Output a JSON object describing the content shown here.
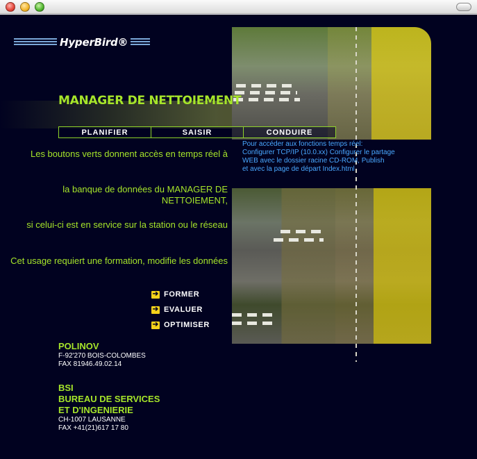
{
  "window": {
    "controls": [
      "close",
      "minimize",
      "zoom"
    ]
  },
  "logo": {
    "text": "HyperBird®"
  },
  "title": "MANAGER DE NETTOIEMENT",
  "nav": [
    {
      "label": "PLANIFIER"
    },
    {
      "label": "SAISIR"
    },
    {
      "label": "CONDUIRE"
    }
  ],
  "info": {
    "line1": "Pour accéder aux fonctions temps réel:",
    "line2": "Configurer TCP/IP (10.0.xx) Configurer le partage",
    "line3": "WEB avec le dossier racine CD-ROM, Publish",
    "line4": "et avec la page de départ Index.html"
  },
  "paragraphs": {
    "p1": "Les boutons verts donnent accès en temps réel à",
    "p2": "la banque de données du MANAGER DE NETTOIEMENT,",
    "p3": "si celui-ci est en service sur la station ou le réseau",
    "p4": "Cet usage requiert une formation, modifie les données"
  },
  "actions": [
    {
      "label": "FORMER",
      "icon": "arrow-right-icon"
    },
    {
      "label": "EVALUER",
      "icon": "arrow-right-icon"
    },
    {
      "label": "OPTIMISER",
      "icon": "arrow-right-icon"
    }
  ],
  "addresses": {
    "polinov": {
      "name": "POLINOV",
      "line1": "F-92'270 BOIS-COLOMBES",
      "line2": "FAX 81946.49.02.14"
    },
    "bsi": {
      "name1": "BSI",
      "name2": "BUREAU DE SERVICES",
      "name3": "ET D'INGENIERIE",
      "line1": "CH-1007 LAUSANNE",
      "line2": "FAX +41(21)617 17 80"
    }
  },
  "colors": {
    "background": "#010220",
    "accent_green": "#a6e52a",
    "info_blue": "#49a8ff",
    "arrow_yellow": "#f4d21a"
  }
}
